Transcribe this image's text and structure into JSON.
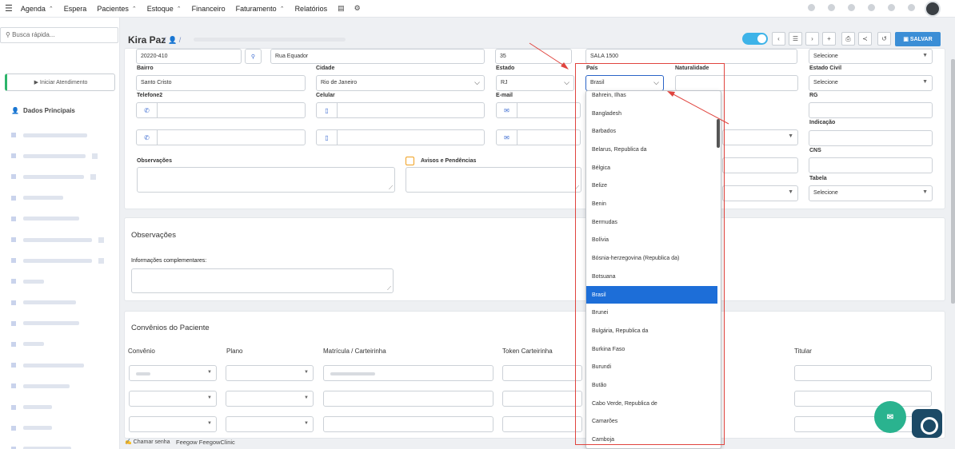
{
  "nav": {
    "items": [
      "Agenda",
      "Espera",
      "Pacientes",
      "Estoque",
      "Financeiro",
      "Faturamento",
      "Relatórios"
    ]
  },
  "sidebar": {
    "search_placeholder": "Busca rápida...",
    "start_button": "▶ Iniciar Atendimento",
    "section_title": "Dados Principais"
  },
  "header": {
    "patient_name": "Kira Paz",
    "save_label": "SALVAR"
  },
  "form": {
    "cep": "20220-410",
    "endereco": "Rua Equador",
    "numero": "35",
    "complemento": "SALA 1500",
    "estado_civil_top": "Selecione",
    "labels": {
      "bairro": "Bairro",
      "cidade": "Cidade",
      "estado": "Estado",
      "pais": "País",
      "naturalidade": "Naturalidade",
      "estado_civil": "Estado Civil",
      "telefone2": "Telefone2",
      "celular": "Celular",
      "email": "E-mail",
      "rg": "RG",
      "indicacao": "Indicação",
      "cns": "CNS",
      "observacoes": "Observações",
      "avisos": "Avisos e Pendências",
      "tabela": "Tabela"
    },
    "bairro": "Santo Cristo",
    "cidade": "Rio de Janeiro",
    "estado": "RJ",
    "pais": "Brasil",
    "estado_civil": "Selecione",
    "tabela": "Selecione"
  },
  "observacoes_section": {
    "title": "Observações",
    "info_label": "Informações complementares:"
  },
  "convenios": {
    "title": "Convênios do Paciente",
    "columns": [
      "Convênio",
      "Plano",
      "Matrícula / Carteirinha",
      "Token Carteirinha",
      "Titular"
    ]
  },
  "country_dropdown": {
    "items": [
      "Bahrein, Ilhas",
      "Bangladesh",
      "Barbados",
      "Belarus, Republica da",
      "Bélgica",
      "Belize",
      "Benin",
      "Bermudas",
      "Bolívia",
      "Bósnia-herzegovina (Republica da)",
      "Botsuana",
      "Brasil",
      "Brunei",
      "Bulgária, Republica da",
      "Burkina Faso",
      "Burundi",
      "Butão",
      "Cabo Verde, Republica de",
      "Camarões",
      "Camboja"
    ],
    "selected": "Brasil"
  },
  "footer": {
    "sign_label": "✍ Chamar senha",
    "brand": "Feegow FeegowClinic"
  },
  "colors": {
    "accent": "#3b8ed6",
    "selected": "#1d6ed8",
    "annotation": "#e0443e",
    "start_green": "#2cb56a"
  }
}
